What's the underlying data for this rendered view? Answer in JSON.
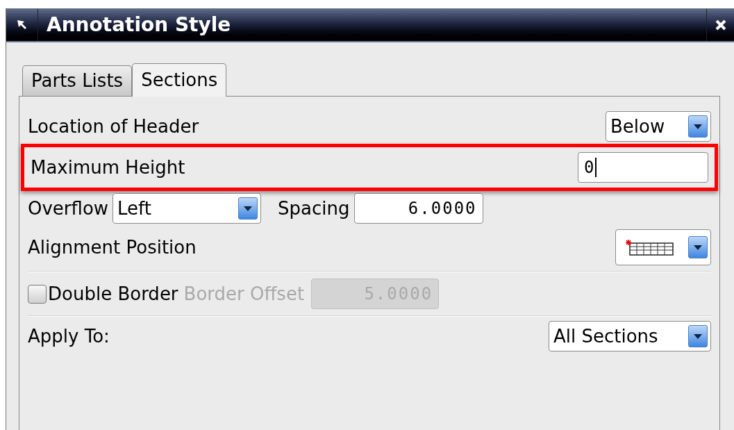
{
  "window": {
    "title": "Annotation Style"
  },
  "tabs": [
    {
      "label": "Parts Lists",
      "selected": false
    },
    {
      "label": "Sections",
      "selected": true
    }
  ],
  "rows": [
    {
      "kind": "dropdown",
      "label": "Location of Header",
      "value": "Below"
    },
    {
      "kind": "field",
      "label": "Maximum Height",
      "value": "0",
      "highlighted": true
    },
    {
      "kind": "pair",
      "dropdown": {
        "label": "Overflow",
        "value": "Left"
      },
      "field": {
        "label": "Spacing",
        "value": "6.0000"
      }
    },
    {
      "kind": "icon-dropdown",
      "label": "Alignment Position"
    },
    {
      "kind": "divider"
    },
    {
      "kind": "checkbox",
      "label": "Double Border",
      "checked": false,
      "field": {
        "label": "Border Offset",
        "value": "5.0000",
        "disabled": true
      }
    },
    {
      "kind": "divider"
    },
    {
      "kind": "dropdown",
      "label": "Apply To:",
      "value": "All Sections"
    }
  ]
}
